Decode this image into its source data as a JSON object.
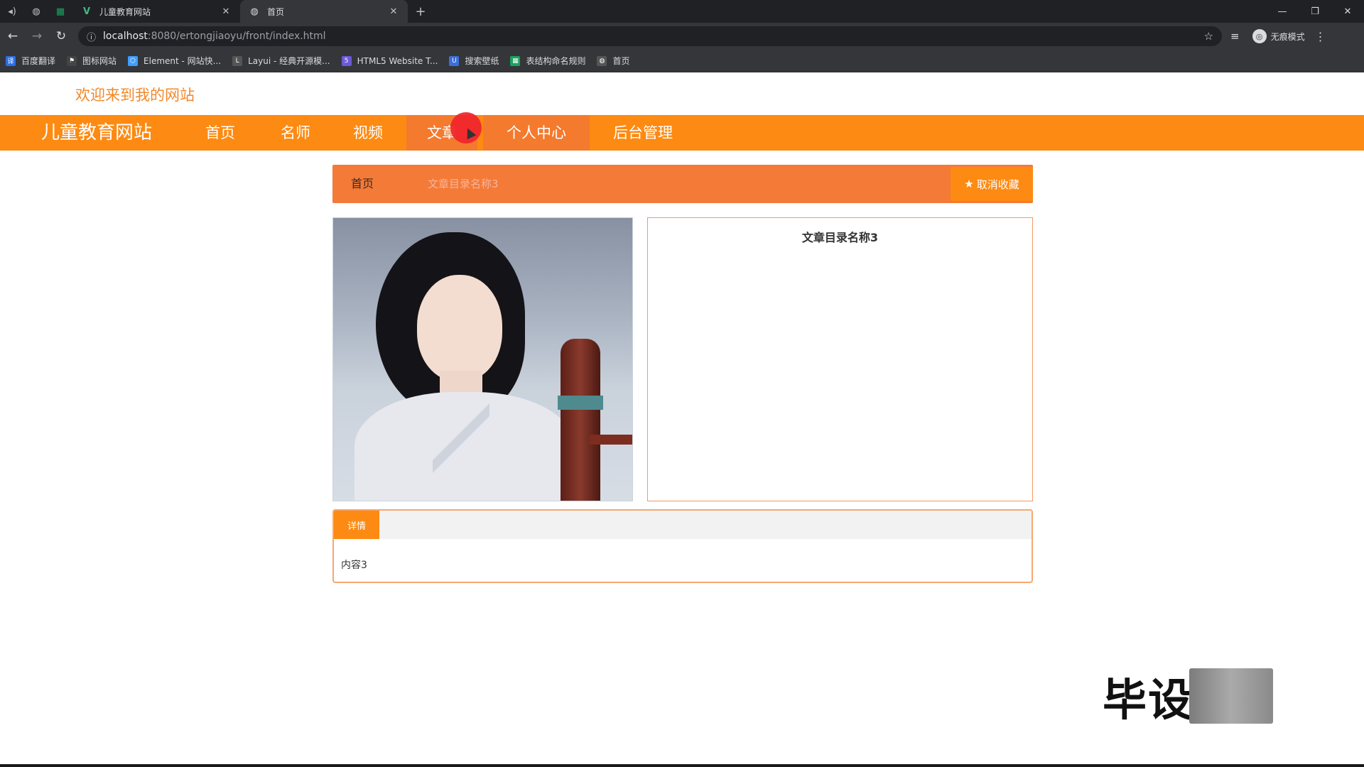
{
  "browser": {
    "tabs": [
      {
        "title": "儿童教育网站",
        "favicon": "vue-icon",
        "active": false
      },
      {
        "title": "首页",
        "favicon": "globe-icon",
        "active": true
      }
    ],
    "new_tab": "+",
    "url_host": "localhost",
    "url_rest": ":8080/ertongjiaoyu/front/index.html",
    "profile_label": "无痕模式",
    "bookmarks": [
      {
        "label": "百度翻译",
        "color": "#2d6ee6",
        "glyph": "译"
      },
      {
        "label": "图标网站",
        "color": "#444",
        "glyph": "⚑"
      },
      {
        "label": "Element - 网站快...",
        "color": "#409eff",
        "glyph": "⬡"
      },
      {
        "label": "Layui - 经典开源模...",
        "color": "#555",
        "glyph": "L"
      },
      {
        "label": "HTML5 Website T...",
        "color": "#6b5bd6",
        "glyph": "5"
      },
      {
        "label": "搜索壁纸",
        "color": "#3b6fd8",
        "glyph": "U"
      },
      {
        "label": "表结构命名规则",
        "color": "#1aa260",
        "glyph": "▦"
      },
      {
        "label": "首页",
        "color": "#555",
        "glyph": "◍"
      }
    ]
  },
  "site": {
    "welcome": "欢迎来到我的网站",
    "brand": "儿童教育网站",
    "nav": [
      {
        "label": "首页"
      },
      {
        "label": "名师"
      },
      {
        "label": "视频"
      },
      {
        "label": "文章"
      },
      {
        "label": "个人中心"
      },
      {
        "label": "后台管理"
      }
    ],
    "breadcrumb": {
      "home": "首页",
      "current": "文章目录名称3"
    },
    "unfavorite_label": "取消收藏",
    "article": {
      "title": "文章目录名称3"
    },
    "detail": {
      "tab_label": "详情",
      "content": "内容3"
    },
    "watermark": "毕设"
  },
  "colors": {
    "primary": "#fd8a12",
    "breadcrumb_bg": "#f47a38",
    "welcome_text": "#f0892c"
  }
}
